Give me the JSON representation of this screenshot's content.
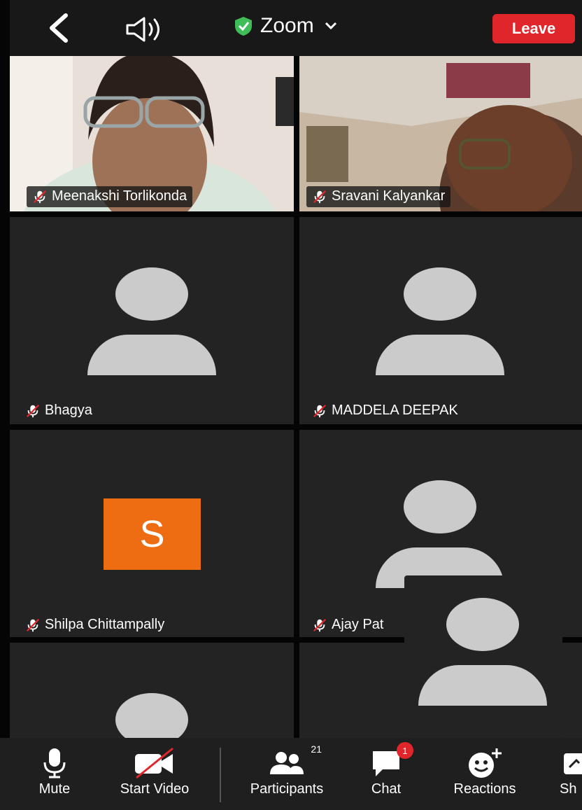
{
  "header": {
    "app_title": "Zoom",
    "leave_label": "Leave",
    "icons": [
      "back-icon",
      "speaker-icon",
      "shield-check-icon",
      "chevron-down-icon"
    ]
  },
  "colors": {
    "leave_red": "#e0262b",
    "shield_green": "#3fbd58",
    "avatar_orange": "#ee6c12",
    "tile_bg": "#232323",
    "toolbar_bg": "#1f1f1f"
  },
  "participants": [
    {
      "name": "Meenakshi Torlikonda",
      "muted": true,
      "video": true
    },
    {
      "name": "Sravani Kalyankar",
      "muted": true,
      "video": true
    },
    {
      "name": "Bhagya",
      "muted": true,
      "video": false
    },
    {
      "name": "MADDELA DEEPAK",
      "muted": true,
      "video": false
    },
    {
      "name": "Shilpa Chittampally",
      "muted": true,
      "video": false,
      "avatar_letter": "S"
    },
    {
      "name": "Ajay Pat",
      "muted": true,
      "video": false
    }
  ],
  "toolbar": {
    "mute_label": "Mute",
    "start_video_label": "Start Video",
    "participants_label": "Participants",
    "participants_count": "21",
    "chat_label": "Chat",
    "chat_badge": "1",
    "reactions_label": "Reactions",
    "share_label": "Sh"
  }
}
